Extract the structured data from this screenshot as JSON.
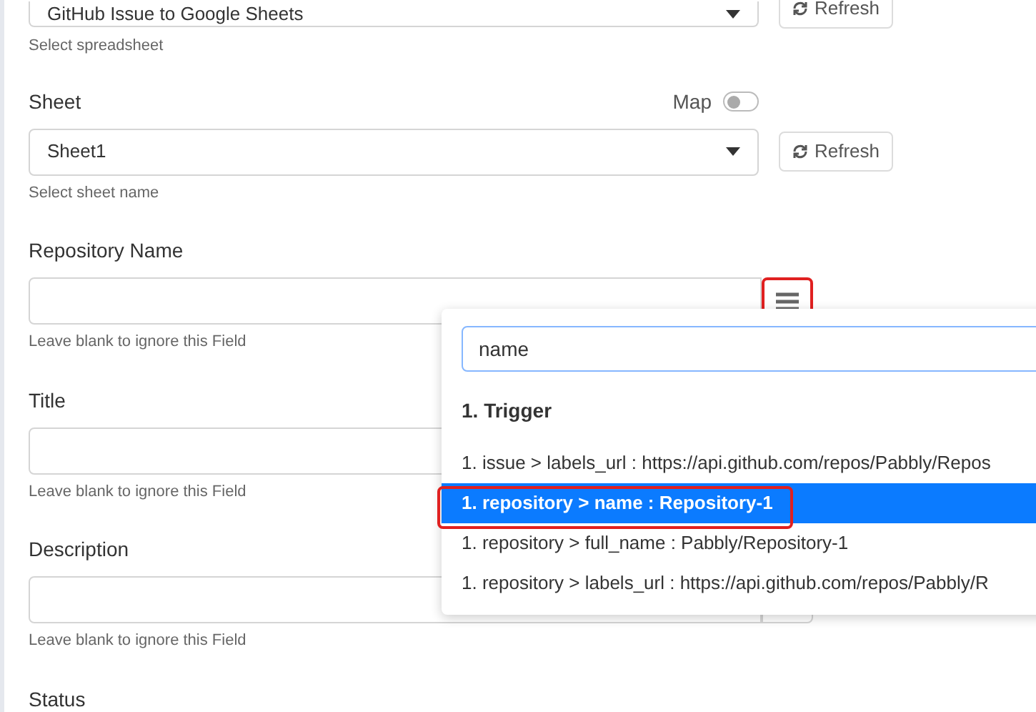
{
  "spreadsheet": {
    "value": "GitHub Issue to Google Sheets",
    "help": "Select spreadsheet",
    "refresh": "Refresh"
  },
  "sheet": {
    "label": "Sheet",
    "map_label": "Map",
    "map_on": false,
    "value": "Sheet1",
    "help": "Select sheet name",
    "refresh": "Refresh"
  },
  "fields": [
    {
      "label": "Repository Name",
      "help": "Leave blank to ignore this Field",
      "highlighted": true
    },
    {
      "label": "Title",
      "help": "Leave blank to ignore this Field"
    },
    {
      "label": "Description",
      "help": "Leave blank to ignore this Field"
    },
    {
      "label": "Status"
    }
  ],
  "dropdown": {
    "search": "name",
    "group": "1. Trigger",
    "items": [
      {
        "text": "1. issue > labels_url : https://api.github.com/repos/Pabbly/Repos",
        "selected": false
      },
      {
        "text": "1. repository > name : Repository-1",
        "selected": true
      },
      {
        "text": "1. repository > full_name : Pabbly/Repository-1",
        "selected": false
      },
      {
        "text": "1. repository > labels_url : https://api.github.com/repos/Pabbly/R",
        "selected": false
      }
    ]
  }
}
